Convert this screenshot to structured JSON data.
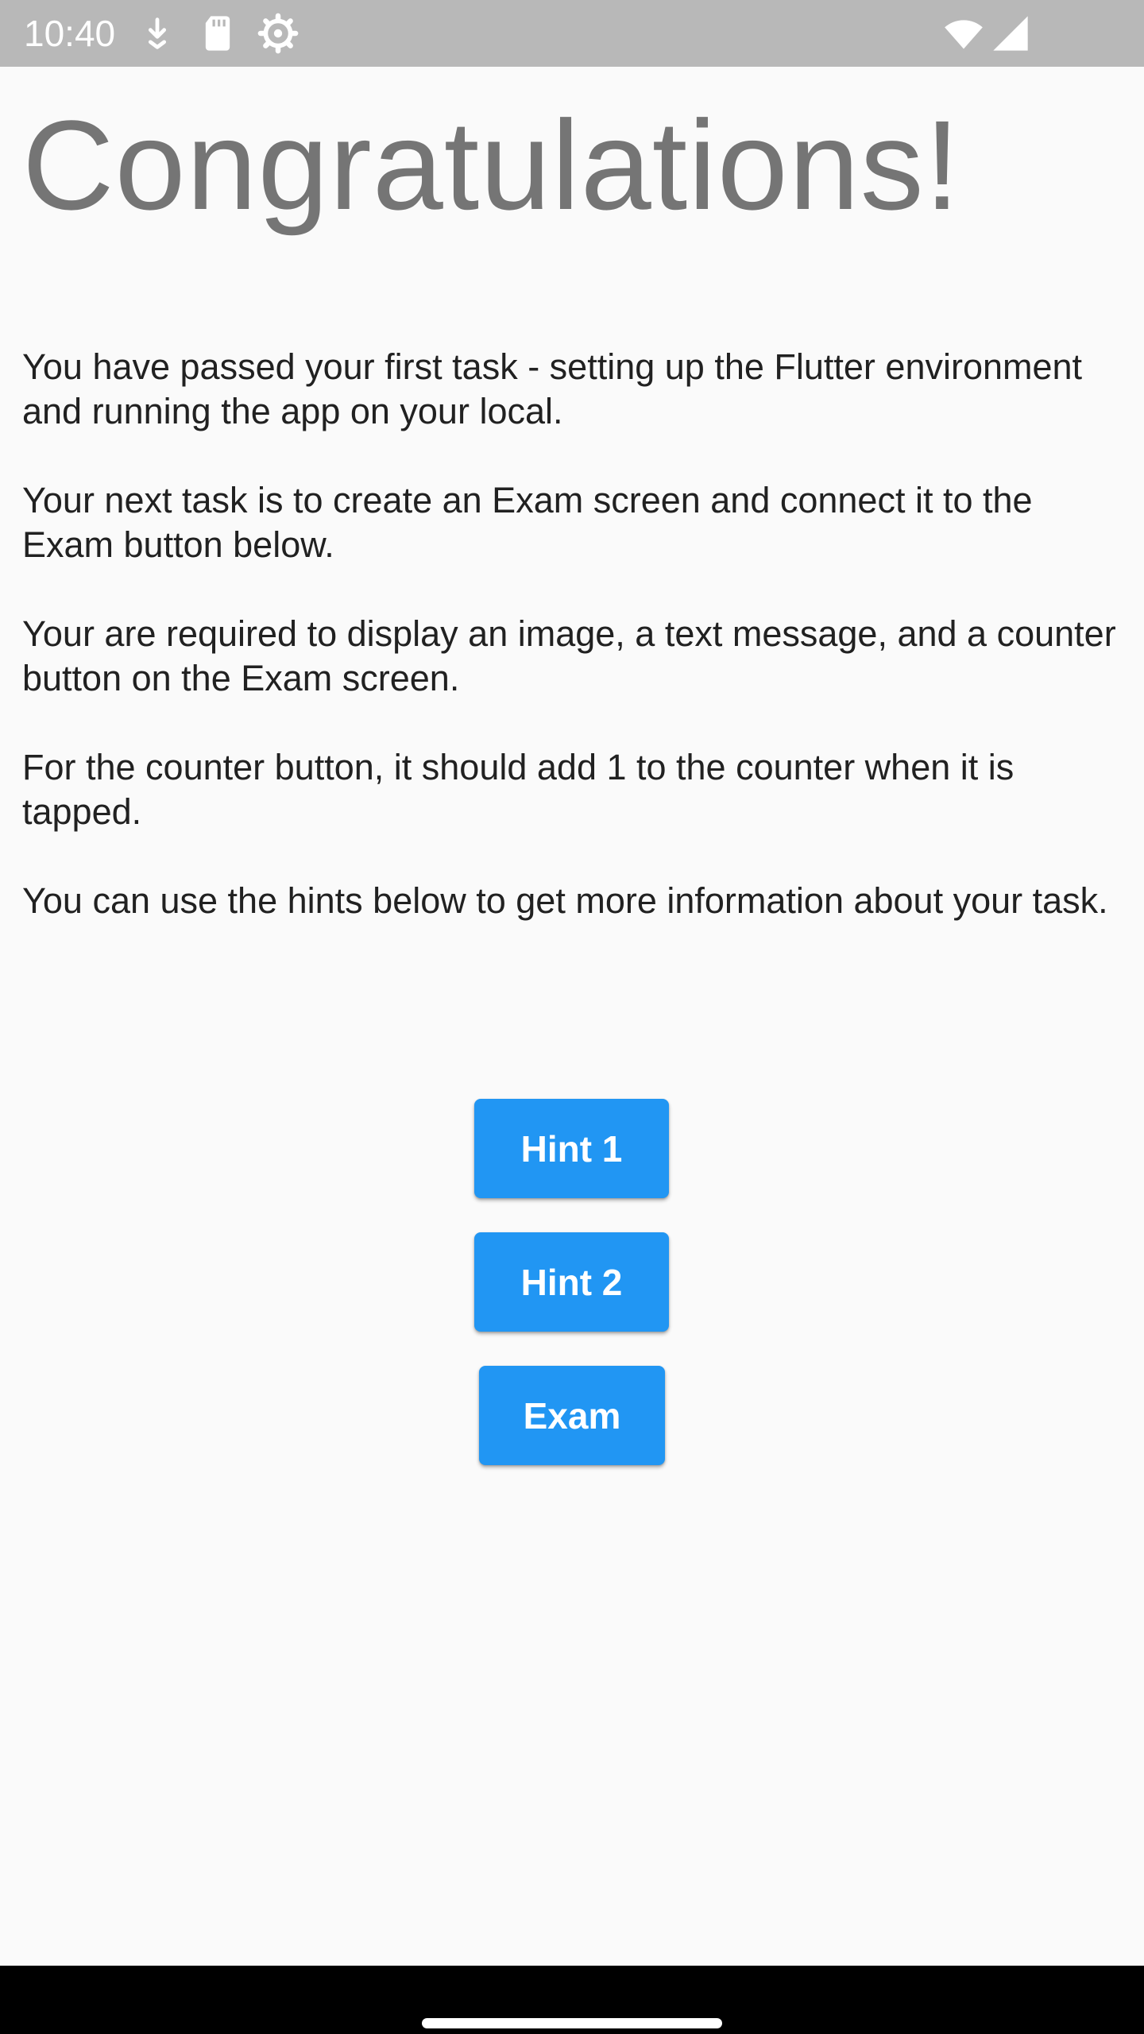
{
  "status_bar": {
    "time": "10:40",
    "icons": [
      "download-icon",
      "sd-card-icon",
      "settings-icon",
      "wifi-icon",
      "signal-icon"
    ]
  },
  "main": {
    "title": "Congratulations!",
    "paragraphs": [
      "You have passed your first task - setting up the Flutter environment and running the app on your local.",
      "Your next task is to create an Exam screen and connect it to the Exam button below.",
      "Your are required to display an image, a text message, and a counter button on the Exam screen.",
      "For the counter button, it should add 1 to the counter when it is tapped.",
      "You can use the hints below to get more information about your task."
    ],
    "buttons": {
      "hint1": "Hint 1",
      "hint2": "Hint 2",
      "exam": "Exam"
    }
  },
  "colors": {
    "button": "#2196f3",
    "title": "#757575",
    "status_bar": "#b8b8b8",
    "background": "#fafafa"
  }
}
